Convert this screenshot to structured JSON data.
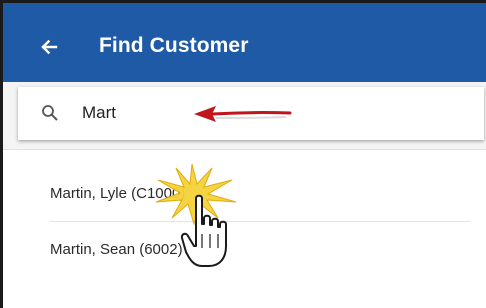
{
  "app_bar": {
    "title": "Find Customer",
    "back_icon": "arrow-left-icon",
    "color": "#1f5aa6"
  },
  "search": {
    "icon": "search-icon",
    "value": "Mart"
  },
  "results": [
    {
      "label": "Martin, Lyle (C1000)"
    },
    {
      "label": "Martin, Sean (6002)"
    }
  ],
  "annotations": {
    "arrow_color": "#c0161c",
    "cursor_icon": "hand-pointer-icon",
    "click_burst_color": "#f2c200"
  }
}
